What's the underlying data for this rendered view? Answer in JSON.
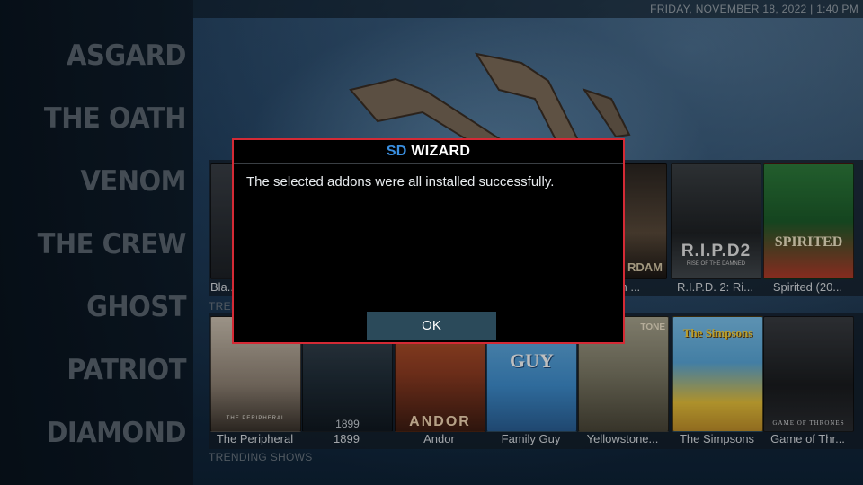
{
  "header": {
    "datetime": "FRIDAY, NOVEMBER 18, 2022 | 1:40 PM"
  },
  "sidebar": {
    "items": [
      {
        "label": "ASGARD"
      },
      {
        "label": "THE OATH"
      },
      {
        "label": "VENOM"
      },
      {
        "label": "THE CREW"
      },
      {
        "label": "GHOST"
      },
      {
        "label": "PATRIOT"
      },
      {
        "label": "DIAMOND"
      }
    ]
  },
  "shelves": {
    "top": {
      "title": "TRENDING",
      "items": [
        {
          "label": "Bla..."
        },
        {
          "label": "...am ..."
        },
        {
          "label": "R.I.P.D. 2: Ri..."
        },
        {
          "label": "Spirited (20..."
        }
      ],
      "poster_text": {
        "amsterdam": "RDAM",
        "ripd": "R.I.P.D2",
        "ripd_sub": "RISE OF THE DAMNED",
        "spirited": "SPIRITED"
      }
    },
    "bottom": {
      "title": "TRENDING SHOWS",
      "items": [
        {
          "label": "The Peripheral"
        },
        {
          "label": "1899"
        },
        {
          "label": "Andor"
        },
        {
          "label": "Family Guy"
        },
        {
          "label": "Yellowstone..."
        },
        {
          "label": "The Simpsons"
        },
        {
          "label": "Game of Thr..."
        }
      ],
      "poster_text": {
        "peripheral": "THE PERIPHERAL",
        "n1899": "1899",
        "andor": "ANDOR",
        "familyguy": "GUY",
        "yellowstone": "TONE",
        "simpsons": "The Simpsons",
        "got": "GAME OF THRONES"
      }
    }
  },
  "dialog": {
    "title_accent": "SD",
    "title_rest": "WIZARD",
    "message": "The selected addons were all installed successfully.",
    "ok_label": "OK"
  },
  "colors": {
    "dialog_border": "#d42a35",
    "title_accent": "#3a8fe0",
    "ok_button": "#2b4a5a"
  }
}
